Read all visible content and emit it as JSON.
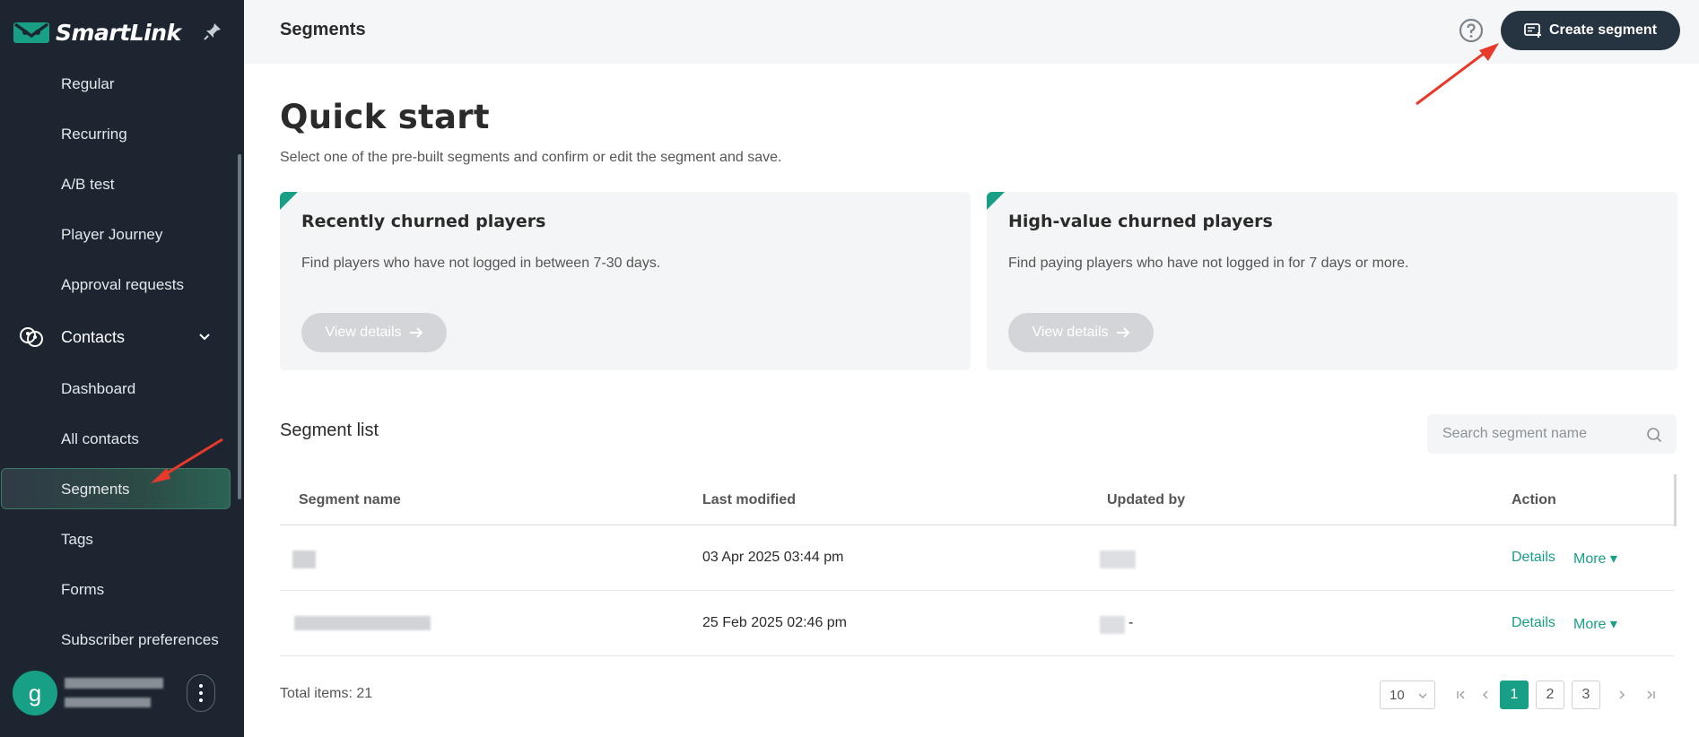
{
  "app": {
    "brand": "SmartLink"
  },
  "sidebar": {
    "items_top": [
      "Regular",
      "Recurring",
      "A/B test",
      "Player Journey",
      "Approval requests"
    ],
    "group": {
      "label": "Contacts",
      "icon": "contacts-icon"
    },
    "items_contacts": [
      "Dashboard",
      "All contacts",
      "Segments",
      "Tags",
      "Forms",
      "Subscriber preferences"
    ],
    "active_item": "Segments",
    "user": {
      "avatar_letter": "g"
    }
  },
  "header": {
    "title": "Segments",
    "create_label": "Create segment"
  },
  "quick_start": {
    "title": "Quick start",
    "subtitle": "Select one of the pre-built segments and confirm or edit the segment and save.",
    "cards": [
      {
        "title": "Recently churned players",
        "desc": "Find players who have not logged in between 7-30 days.",
        "button": "View details"
      },
      {
        "title": "High-value churned players",
        "desc": "Find paying players who have not logged in for 7 days or more.",
        "button": "View details"
      }
    ]
  },
  "segment_list": {
    "title": "Segment list",
    "search_placeholder": "Search segment name",
    "columns": [
      "Segment name",
      "Last modified",
      "Updated by",
      "Action"
    ],
    "rows": [
      {
        "last_modified": "03 Apr 2025 03:44 pm",
        "updated_by": "",
        "action_details": "Details",
        "action_more": "More ▾"
      },
      {
        "last_modified": "25 Feb 2025 02:46 pm",
        "updated_by": "-",
        "action_details": "Details",
        "action_more": "More ▾"
      }
    ],
    "total": "Total items: 21",
    "page_size": "10",
    "pages": [
      "1",
      "2",
      "3"
    ],
    "current_page": "1"
  },
  "colors": {
    "accent": "#17a085",
    "sidebar_bg": "#1c2530",
    "annotation_arrow": "#e8392b"
  }
}
